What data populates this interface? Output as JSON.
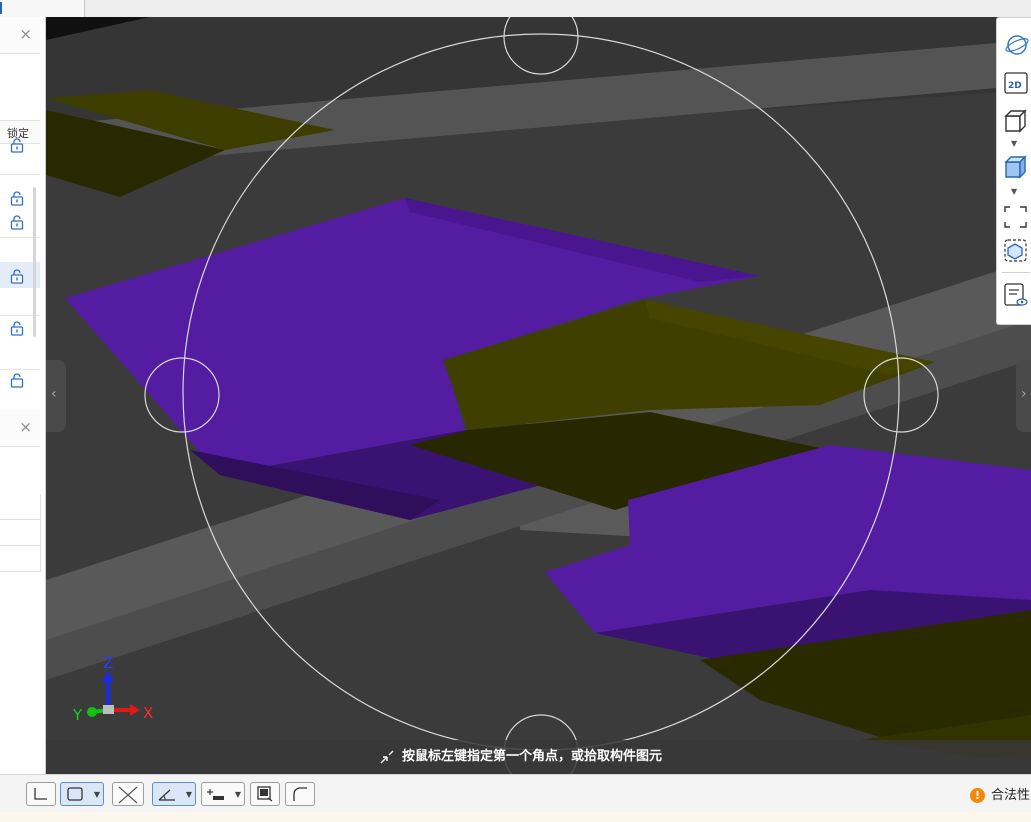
{
  "left_panel": {
    "close_glyph": "×",
    "column_header": "锁定",
    "lock_icon": "lock-icon"
  },
  "viewport": {
    "background": "#3b3b3b",
    "purple": "#541ca0",
    "olive": "#3a3a00",
    "collapse_left_glyph": "‹",
    "collapse_right_glyph": "›"
  },
  "axis": {
    "z": "Z",
    "y": "Y",
    "x": "X"
  },
  "right_tools": {
    "view_2d_label": "2D",
    "items": [
      "orbit-icon",
      "view-2d-icon",
      "cube-icon",
      "cube-shaded-icon",
      "zoom-extent-icon",
      "isolate-icon",
      "display-settings-icon"
    ]
  },
  "status": {
    "prompt": "按鼠标左键指定第一个角点，或拾取构件图元",
    "license_text": "合法性",
    "license_badge": "!"
  }
}
